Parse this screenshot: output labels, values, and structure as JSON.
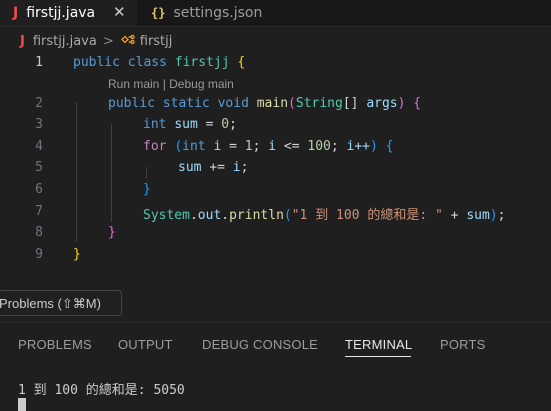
{
  "tabs": [
    {
      "icon": "J",
      "label": "firstjj.java",
      "active": true,
      "close": "✕"
    },
    {
      "icon": "{}",
      "label": "settings.json",
      "active": false
    }
  ],
  "breadcrumb": {
    "file_icon": "J",
    "file": "firstjj.java",
    "separator": ">",
    "symbol_icon": "class-symbol-icon",
    "symbol": "firstjj"
  },
  "editor": {
    "code_lens": "Run main | Debug main",
    "line_numbers": [
      "1",
      "2",
      "3",
      "4",
      "5",
      "6",
      "7",
      "8",
      "9"
    ],
    "lines": {
      "l1": [
        "public",
        "class",
        "firstjj",
        "{"
      ],
      "l2": [
        "public",
        "static",
        "void",
        "main",
        "(",
        "String",
        "[]",
        "args",
        ")",
        "{"
      ],
      "l3": [
        "int",
        "sum",
        "=",
        "0",
        ";"
      ],
      "l4": [
        "for",
        "(",
        "int",
        "i",
        "=",
        "1",
        ";",
        "i",
        "<=",
        "100",
        ";",
        "i++",
        ")",
        "{"
      ],
      "l5": [
        "sum",
        "+=",
        "i",
        ";"
      ],
      "l6": [
        "}"
      ],
      "l7": [
        "System",
        ".",
        "out",
        ".",
        "println",
        "(",
        "\"1 到 100 的總和是: \"",
        "+",
        "sum",
        ")",
        ";"
      ],
      "l8": [
        "}"
      ],
      "l9": [
        "}"
      ]
    }
  },
  "tooltip": "Problems (⇧⌘M)",
  "panel": {
    "tabs": [
      "PROBLEMS",
      "OUTPUT",
      "DEBUG CONSOLE",
      "TERMINAL",
      "PORTS"
    ],
    "active_tab": "TERMINAL"
  },
  "terminal": {
    "output": "1 到 100 的總和是: 5050"
  },
  "colors": {
    "background": "#1f1f1f",
    "keyword": "#569cd6",
    "control": "#c586c0",
    "type": "#4ec9b0",
    "function": "#dcdcaa",
    "number": "#b5cea8",
    "string": "#ce9178",
    "java_icon": "#f14c4c"
  }
}
